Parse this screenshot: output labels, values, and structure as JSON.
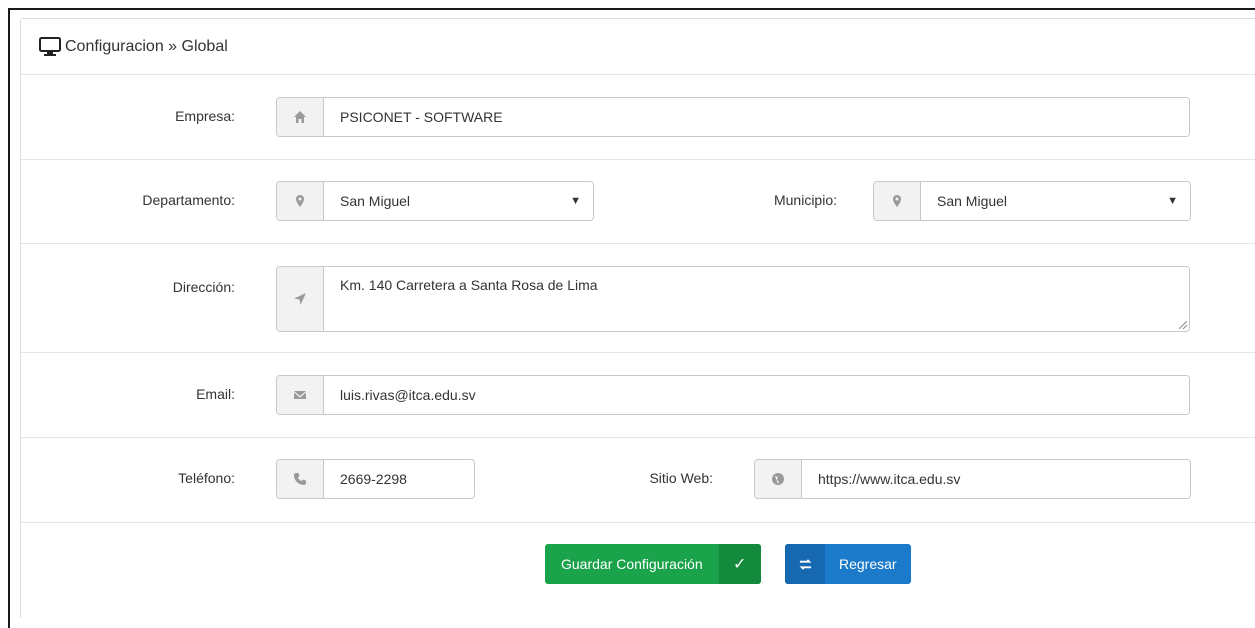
{
  "header": {
    "title": "Configuracion » Global"
  },
  "form": {
    "empresa": {
      "label": "Empresa:",
      "value": "PSICONET - SOFTWARE",
      "icon": "home-icon"
    },
    "departamento": {
      "label": "Departamento:",
      "value": "San Miguel",
      "icon": "map-marker-icon"
    },
    "municipio": {
      "label": "Municipio:",
      "value": "San Miguel",
      "icon": "map-marker-icon"
    },
    "direccion": {
      "label": "Dirección:",
      "value": "Km. 140 Carretera a Santa Rosa de Lima",
      "icon": "location-arrow-icon"
    },
    "email": {
      "label": "Email:",
      "value": "luis.rivas@itca.edu.sv",
      "icon": "envelope-icon"
    },
    "telefono": {
      "label": "Teléfono:",
      "value": "2669-2298",
      "icon": "phone-icon"
    },
    "sitio_web": {
      "label": "Sitio Web:",
      "value": "https://www.itca.edu.sv",
      "icon": "globe-icon"
    }
  },
  "actions": {
    "save_label": "Guardar Configuración",
    "back_label": "Regresar"
  },
  "colors": {
    "save": "#1aa34a",
    "back": "#1b7ac9"
  }
}
